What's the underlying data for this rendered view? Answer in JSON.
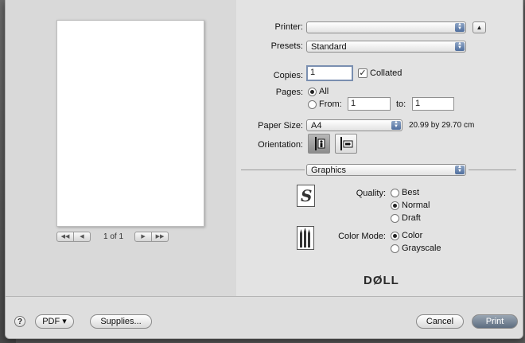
{
  "preview": {
    "page_indicator": "1 of 1"
  },
  "settings": {
    "printer_label": "Printer:",
    "printer_value": "",
    "presets_label": "Presets:",
    "presets_value": "Standard",
    "copies_label": "Copies:",
    "copies_value": "1",
    "collated_label": "Collated",
    "collated_checked": true,
    "pages_label": "Pages:",
    "pages_all_label": "All",
    "pages_from_label": "From:",
    "pages_from_value": "1",
    "pages_to_label": "to:",
    "pages_to_value": "1",
    "paper_size_label": "Paper Size:",
    "paper_size_value": "A4",
    "paper_size_dims": "20.99 by 29.70 cm",
    "orientation_label": "Orientation:",
    "section_value": "Graphics"
  },
  "graphics": {
    "quality_label": "Quality:",
    "quality_options": [
      "Best",
      "Normal",
      "Draft"
    ],
    "quality_selected": "Normal",
    "color_mode_label": "Color Mode:",
    "color_mode_options": [
      "Color",
      "Grayscale"
    ],
    "color_mode_selected": "Color",
    "brand_logo": "DØLL"
  },
  "footer": {
    "help_label": "?",
    "pdf_label": "PDF ▾",
    "supplies_label": "Supplies...",
    "cancel_label": "Cancel",
    "print_label": "Print"
  }
}
